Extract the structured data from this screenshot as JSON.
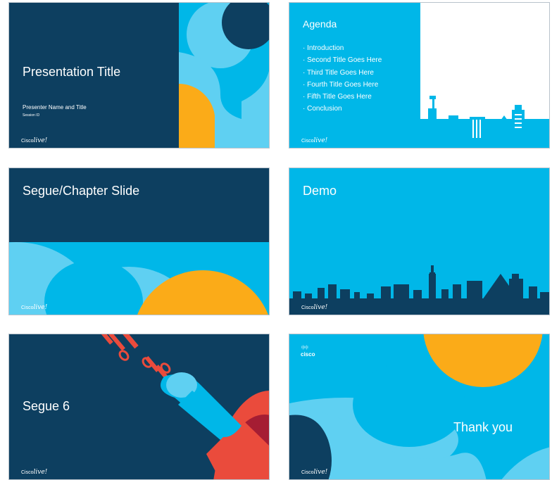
{
  "slides": [
    {
      "title": "Presentation Title",
      "presenter": "Presenter Name and Title",
      "session": "Session ID",
      "logo": {
        "cisco": "Cisco",
        "live": "live!"
      }
    },
    {
      "title": "Agenda",
      "items": [
        "Introduction",
        "Second Title Goes Here",
        "Third Title Goes Here",
        "Fourth Title Goes Here",
        "Fifth Title Goes Here",
        "Conclusion"
      ],
      "logo": {
        "cisco": "Cisco",
        "live": "live!"
      }
    },
    {
      "title": "Segue/Chapter Slide",
      "logo": {
        "cisco": "Cisco",
        "live": "live!"
      }
    },
    {
      "title": "Demo",
      "logo": {
        "cisco": "Cisco",
        "live": "live!"
      }
    },
    {
      "title": "Segue 6",
      "logo": {
        "cisco": "Cisco",
        "live": "live!"
      }
    },
    {
      "title": "Thank you",
      "brand": "cisco",
      "logo": {
        "cisco": "Cisco",
        "live": "live!"
      }
    }
  ],
  "colors": {
    "navy": "#0d3f60",
    "cyan": "#00b7e8",
    "light_cyan": "#5fd0f2",
    "orange": "#fbab18",
    "red": "#ea4b3c",
    "dark_red": "#a51d33"
  }
}
